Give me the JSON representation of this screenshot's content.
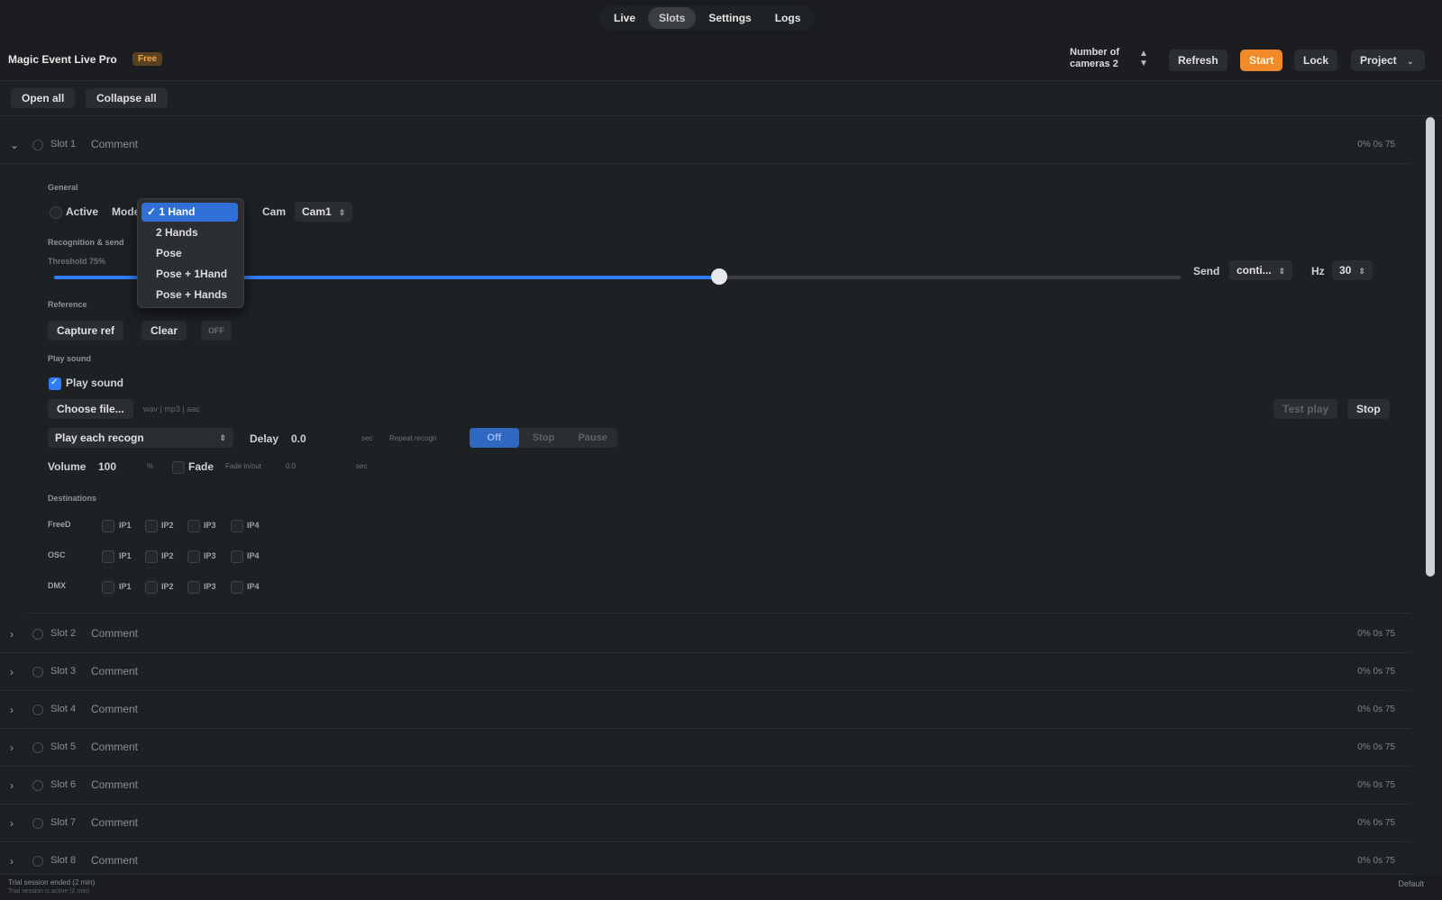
{
  "tabs": [
    "Live",
    "Slots",
    "Settings",
    "Logs"
  ],
  "header": {
    "app_title": "Magic Event Live Pro",
    "badge": "Free",
    "cameras_label_line1": "Number of",
    "cameras_label_line2": "cameras 2",
    "refresh": "Refresh",
    "start": "Start",
    "lock": "Lock",
    "project": "Project"
  },
  "toolbar": {
    "open_all": "Open all",
    "collapse_all": "Collapse all"
  },
  "slot1": {
    "name": "Slot 1",
    "comment": "Comment",
    "stats": "0%   0s 75",
    "general_label": "General",
    "active_label": "Active",
    "mode_label": "Mode",
    "cam_label": "Cam",
    "cam_value": "Cam1",
    "recog_label": "Recognition & send",
    "threshold_label": "Threshold 75%",
    "threshold_value": 0.59,
    "send_label": "Send",
    "send_value": "conti...",
    "hz_label": "Hz",
    "hz_value": "30",
    "reference_label": "Reference",
    "capture_ref": "Capture ref",
    "clear": "Clear",
    "ref_state": "OFF",
    "play_sound_section": "Play sound",
    "play_sound_checkbox": "Play sound",
    "choose_file": "Choose file...",
    "file_types": "wav | mp3 | aac",
    "test_play": "Test play",
    "stop": "Stop",
    "play_each": "Play each recogn",
    "delay_label": "Delay",
    "delay_value": "0.0",
    "sec_unit": "sec",
    "repeat_label": "Repeat recogn",
    "repeat_options": [
      "Off",
      "Stop",
      "Pause"
    ],
    "volume_label": "Volume",
    "volume_value": "100",
    "pct_unit": "%",
    "fade_label": "Fade",
    "fade_inout_label": "Fade in/out",
    "fade_value": "0.0",
    "sec_unit2": "sec",
    "destinations_label": "Destinations",
    "dest_rows": [
      "FreeD",
      "OSC",
      "DMX"
    ],
    "dest_ips": [
      "IP1",
      "IP2",
      "IP3",
      "IP4"
    ]
  },
  "mode_dropdown": {
    "selected": "✓ 1 Hand",
    "options": [
      "2 Hands",
      "Pose",
      "Pose + 1Hand",
      "Pose + Hands"
    ]
  },
  "slots": [
    {
      "name": "Slot 2",
      "comment": "Comment",
      "stats": "0%   0s 75"
    },
    {
      "name": "Slot 3",
      "comment": "Comment",
      "stats": "0%   0s 75"
    },
    {
      "name": "Slot 4",
      "comment": "Comment",
      "stats": "0%   0s 75"
    },
    {
      "name": "Slot 5",
      "comment": "Comment",
      "stats": "0%   0s 75"
    },
    {
      "name": "Slot 6",
      "comment": "Comment",
      "stats": "0%   0s 75"
    },
    {
      "name": "Slot 7",
      "comment": "Comment",
      "stats": "0%   0s 75"
    },
    {
      "name": "Slot 8",
      "comment": "Comment",
      "stats": "0%   0s 75"
    }
  ],
  "footer": {
    "status": "Trial session ended (2 min)",
    "status2": "Trial session is active (2 min)",
    "right": "Default"
  },
  "colors": {
    "accent": "#2f7cf6",
    "start": "#f28a2a",
    "background": "#1e2124"
  }
}
